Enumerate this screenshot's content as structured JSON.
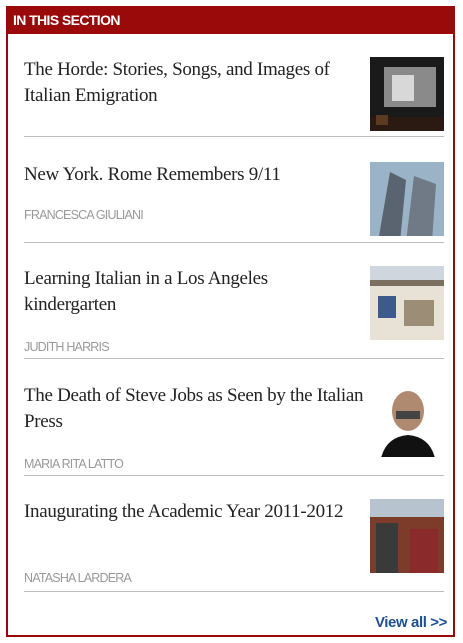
{
  "section": {
    "title": "IN THIS SECTION"
  },
  "items": [
    {
      "title": "The Horde: Stories, Songs, and Images of Italian Emigration",
      "author": "",
      "image": "theater-screen-photo"
    },
    {
      "title": "New York. Rome Remembers 9/11",
      "author": "FRANCESCA GIULIANI",
      "image": "towers-photo"
    },
    {
      "title": "Learning Italian in a Los Angeles kindergarten",
      "author": "JUDITH HARRIS",
      "image": "school-building-photo"
    },
    {
      "title": "The Death of Steve Jobs as Seen by the Italian Press",
      "author": "MARIA RITA LATTO",
      "image": "portrait-photo"
    },
    {
      "title": "Inaugurating the Academic Year 2011-2012",
      "author": "NATASHA LARDERA",
      "image": "brick-building-photo"
    }
  ],
  "footer": {
    "view_all": "View all >>"
  },
  "colors": {
    "accent": "#9b0a0a",
    "link": "#1f4f8f",
    "muted": "#999999"
  }
}
